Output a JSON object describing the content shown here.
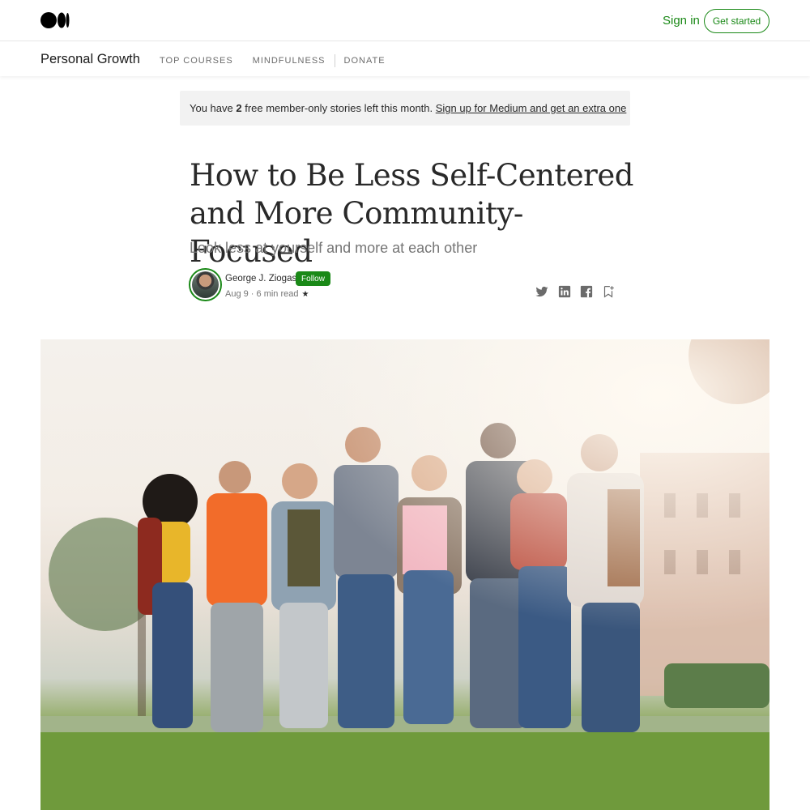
{
  "header": {
    "logo_icon": "medium-logo-icon",
    "sign_in_label": "Sign in",
    "get_started_label": "Get started",
    "accent_color": "#1a8917"
  },
  "publication": {
    "name": "Personal Growth",
    "nav": [
      "TOP COURSES",
      "MINDFULNESS",
      "DONATE"
    ]
  },
  "banner": {
    "text_before": "You have ",
    "count": "2",
    "text_after": " free member-only stories left this month. ",
    "link_text": "Sign up for Medium and get an extra one"
  },
  "article": {
    "title_line1": "How to Be Less Self-Centered",
    "title_line2": "and More Community-Focused",
    "subtitle": "Look less at yourself and more at each other",
    "author": "George J. Ziogas",
    "follow_label": "Follow",
    "date": "Aug 9",
    "read_time": "6 min read",
    "member_star": "★",
    "share_icons": [
      "twitter-icon",
      "linkedin-icon",
      "facebook-icon",
      "bookmark-icon"
    ]
  },
  "hero_image": {
    "description_icon": "group-of-friends-photo"
  }
}
